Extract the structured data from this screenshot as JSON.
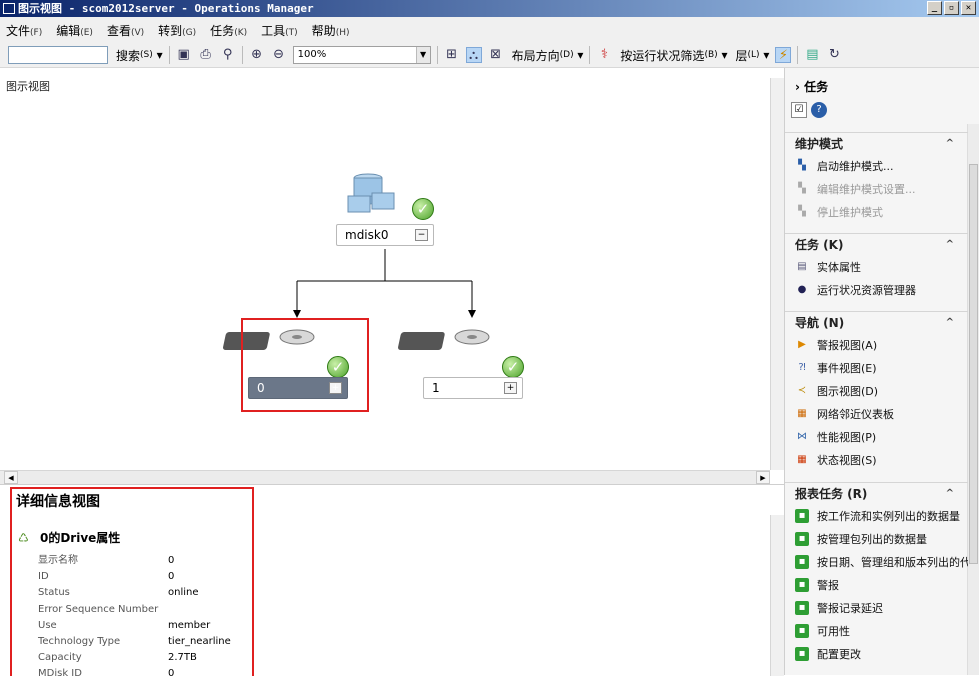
{
  "window": {
    "title": "图示视图 - scom2012server - Operations Manager",
    "controls": [
      "_",
      "▫",
      "✕"
    ]
  },
  "menu": [
    {
      "label": "文件",
      "key": "(F)"
    },
    {
      "label": "编辑",
      "key": "(E)"
    },
    {
      "label": "查看",
      "key": "(V)"
    },
    {
      "label": "转到",
      "key": "(G)"
    },
    {
      "label": "任务",
      "key": "(K)"
    },
    {
      "label": "工具",
      "key": "(T)"
    },
    {
      "label": "帮助",
      "key": "(H)"
    }
  ],
  "toolbar": {
    "search_label": "搜索",
    "search_key": "(S)",
    "zoom": "100%",
    "layout_label": "布局方向",
    "layout_key": "(D)",
    "filter_label": "按运行状况筛选",
    "filter_key": "(B)",
    "layer_label": "层",
    "layer_key": "(L)"
  },
  "diagram": {
    "header": "图示视图",
    "root": {
      "label": "mdisk0",
      "expander": "−",
      "status": "✓"
    },
    "children": [
      {
        "label": "0",
        "expander": "+",
        "status": "✓",
        "selected": true
      },
      {
        "label": "1",
        "expander": "+",
        "status": "✓",
        "selected": false
      }
    ]
  },
  "details": {
    "title": "详细信息视图",
    "subtitle": "0的Drive属性",
    "properties": [
      {
        "key": "显示名称",
        "value": "0"
      },
      {
        "key": "ID",
        "value": "0"
      },
      {
        "key": "Status",
        "value": "online"
      },
      {
        "key": "Error Sequence Number",
        "value": ""
      },
      {
        "key": "Use",
        "value": "member"
      },
      {
        "key": "Technology Type",
        "value": "tier_nearline"
      },
      {
        "key": "Capacity",
        "value": "2.7TB"
      },
      {
        "key": "MDisk ID",
        "value": "0"
      }
    ]
  },
  "tasks_panel": {
    "header": "任务",
    "sections": [
      {
        "title": "维护模式",
        "items": [
          {
            "label": "启动维护模式...",
            "disabled": false,
            "icon": "maintenance-icon"
          },
          {
            "label": "编辑维护模式设置...",
            "disabled": true,
            "icon": "maintenance-icon"
          },
          {
            "label": "停止维护模式",
            "disabled": true,
            "icon": "maintenance-icon"
          }
        ]
      },
      {
        "title": "任务 (K)",
        "items": [
          {
            "label": "实体属性",
            "disabled": false,
            "icon": "properties-icon"
          },
          {
            "label": "运行状况资源管理器",
            "disabled": false,
            "icon": "health-explorer-icon"
          }
        ]
      },
      {
        "title": "导航 (N)",
        "items": [
          {
            "label": "警报视图(A)",
            "disabled": false,
            "icon": "alert-view-icon"
          },
          {
            "label": "事件视图(E)",
            "disabled": false,
            "icon": "event-view-icon"
          },
          {
            "label": "图示视图(D)",
            "disabled": false,
            "icon": "diagram-view-icon"
          },
          {
            "label": "网络邻近仪表板",
            "disabled": false,
            "icon": "network-dashboard-icon"
          },
          {
            "label": "性能视图(P)",
            "disabled": false,
            "icon": "performance-view-icon"
          },
          {
            "label": "状态视图(S)",
            "disabled": false,
            "icon": "state-view-icon"
          }
        ]
      },
      {
        "title": "报表任务 (R)",
        "items": [
          {
            "label": "按工作流和实例列出的数据量",
            "disabled": false,
            "icon": "report-icon"
          },
          {
            "label": "按管理包列出的数据量",
            "disabled": false,
            "icon": "report-icon"
          },
          {
            "label": "按日期、管理组和版本列出的代理",
            "disabled": false,
            "icon": "report-icon"
          },
          {
            "label": "警报",
            "disabled": false,
            "icon": "report-icon"
          },
          {
            "label": "警报记录延迟",
            "disabled": false,
            "icon": "report-icon"
          },
          {
            "label": "可用性",
            "disabled": false,
            "icon": "report-icon"
          },
          {
            "label": "配置更改",
            "disabled": false,
            "icon": "report-icon"
          }
        ]
      }
    ]
  }
}
